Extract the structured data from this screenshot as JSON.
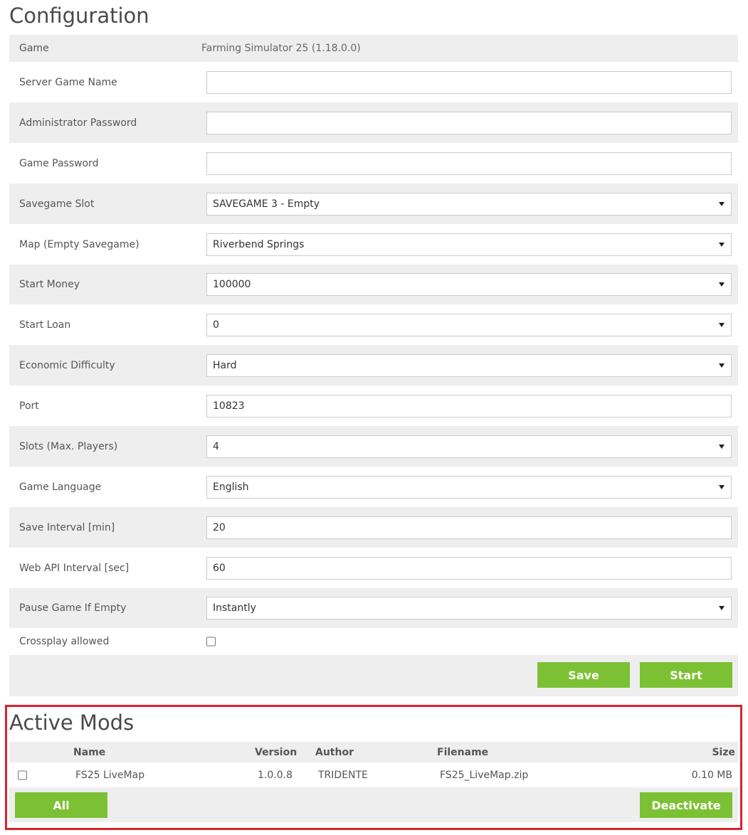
{
  "config": {
    "title": "Configuration",
    "game": {
      "label": "Game",
      "value": "Farming Simulator 25 (1.18.0.0)"
    },
    "server_name": {
      "label": "Server Game Name",
      "value": ""
    },
    "admin_password": {
      "label": "Administrator Password",
      "value": ""
    },
    "game_password": {
      "label": "Game Password",
      "value": ""
    },
    "savegame_slot": {
      "label": "Savegame Slot",
      "value": "SAVEGAME 3 - Empty"
    },
    "map": {
      "label": "Map (Empty Savegame)",
      "value": "Riverbend Springs"
    },
    "start_money": {
      "label": "Start Money",
      "value": "100000"
    },
    "start_loan": {
      "label": "Start Loan",
      "value": "0"
    },
    "economic_difficulty": {
      "label": "Economic Difficulty",
      "value": "Hard"
    },
    "port": {
      "label": "Port",
      "value": "10823"
    },
    "slots": {
      "label": "Slots (Max. Players)",
      "value": "4"
    },
    "language": {
      "label": "Game Language",
      "value": "English"
    },
    "save_interval": {
      "label": "Save Interval [min]",
      "value": "20"
    },
    "web_api_interval": {
      "label": "Web API Interval [sec]",
      "value": "60"
    },
    "pause_if_empty": {
      "label": "Pause Game If Empty",
      "value": "Instantly"
    },
    "crossplay": {
      "label": "Crossplay allowed",
      "checked": false
    },
    "save_label": "Save",
    "start_label": "Start"
  },
  "mods": {
    "title": "Active Mods",
    "headers": {
      "name": "Name",
      "version": "Version",
      "author": "Author",
      "filename": "Filename",
      "size": "Size"
    },
    "rows": [
      {
        "name": "FS25 LiveMap",
        "version": "1.0.0.8",
        "author": "TRIDENTE",
        "filename": "FS25_LiveMap.zip",
        "size": "0.10 MB",
        "checked": false
      }
    ],
    "all_label": "All",
    "deactivate_label": "Deactivate"
  },
  "colors": {
    "accent": "#7cc133",
    "row_alt": "#eeeeee",
    "highlight": "#d9232e"
  }
}
